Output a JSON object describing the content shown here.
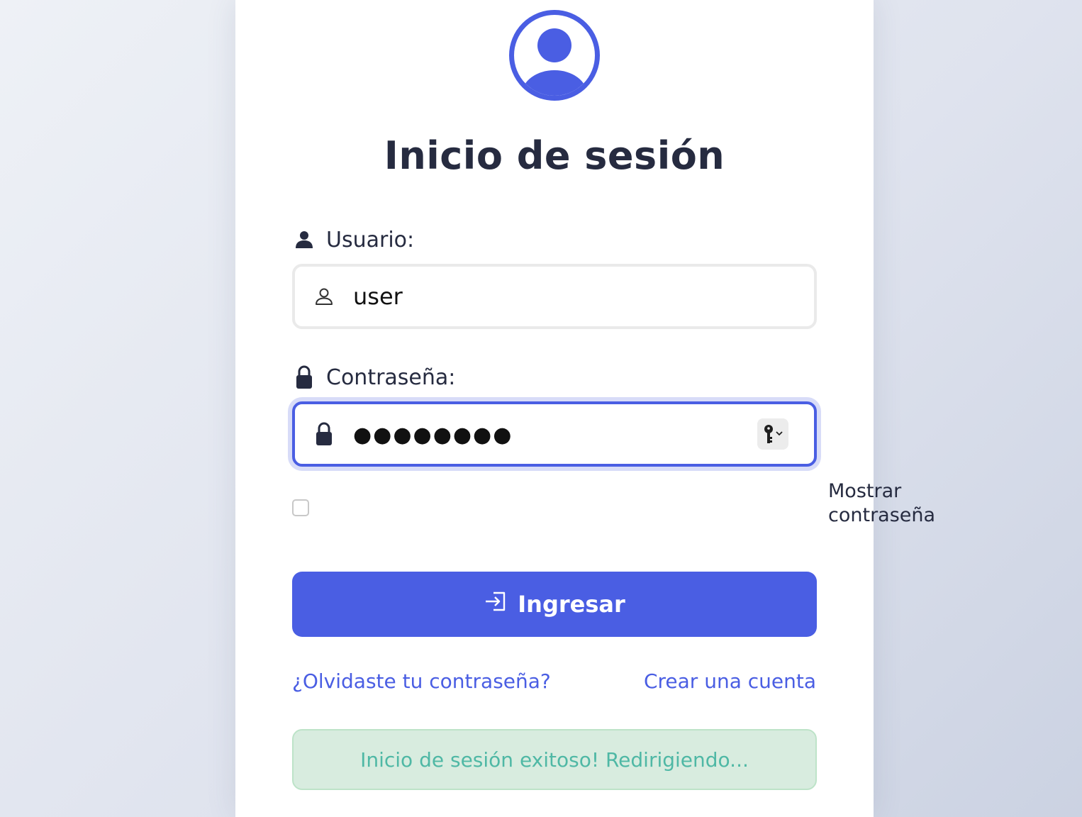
{
  "header": {
    "title": "Inicio de sesión"
  },
  "form": {
    "username_label": "Usuario:",
    "username_value": "user",
    "password_label": "Contraseña:",
    "password_value": "●●●●●●●●",
    "show_password_label": "Mostrar contraseña",
    "show_password_checked": false,
    "submit_label": "Ingresar"
  },
  "links": {
    "forgot": "¿Olvidaste tu contraseña?",
    "create": "Crear una cuenta"
  },
  "status": {
    "message": "Inicio de sesión exitoso! Redirigiendo..."
  },
  "icons": {
    "avatar": "user-circle-icon",
    "username_label": "person-solid-icon",
    "username_field": "person-outline-icon",
    "password_label": "lock-icon",
    "password_field": "lock-icon",
    "password_manager": "key-icon",
    "submit": "login-arrow-icon"
  },
  "colors": {
    "accent": "#4a5ee3",
    "text": "#262b40",
    "success_bg": "#d8ecdf",
    "success_text": "#4fb8a5"
  }
}
